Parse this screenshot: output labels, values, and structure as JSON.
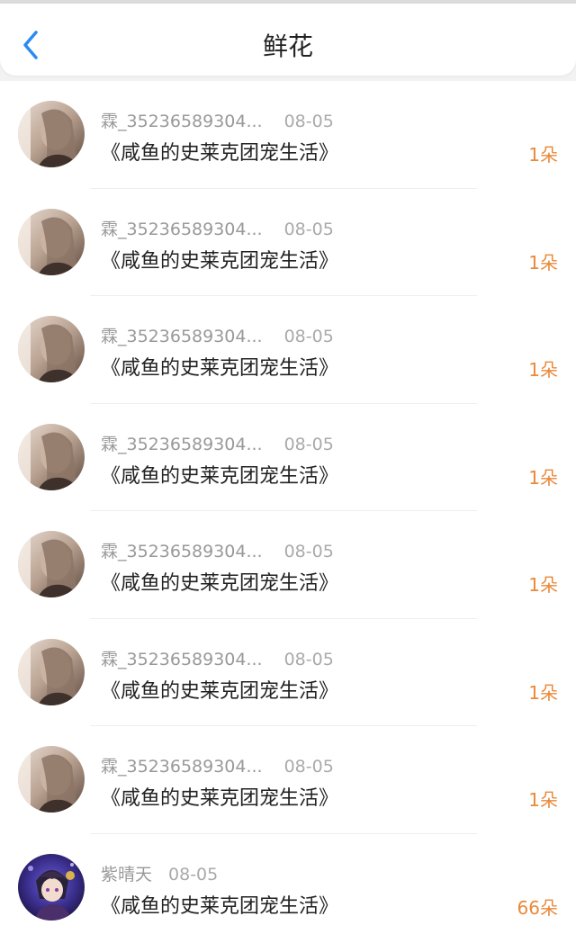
{
  "header": {
    "title": "鲜花",
    "back_icon": "chevron-left-icon",
    "accent": "#2a8cf0"
  },
  "count_color": "#e9893a",
  "records": [
    {
      "user": "霖_35236589304...",
      "date": "08-05",
      "book": "《咸鱼的史莱克团宠生活》",
      "count": "1朵",
      "avatar": "portrait-light"
    },
    {
      "user": "霖_35236589304...",
      "date": "08-05",
      "book": "《咸鱼的史莱克团宠生活》",
      "count": "1朵",
      "avatar": "portrait-light"
    },
    {
      "user": "霖_35236589304...",
      "date": "08-05",
      "book": "《咸鱼的史莱克团宠生活》",
      "count": "1朵",
      "avatar": "portrait-light"
    },
    {
      "user": "霖_35236589304...",
      "date": "08-05",
      "book": "《咸鱼的史莱克团宠生活》",
      "count": "1朵",
      "avatar": "portrait-light"
    },
    {
      "user": "霖_35236589304...",
      "date": "08-05",
      "book": "《咸鱼的史莱克团宠生活》",
      "count": "1朵",
      "avatar": "portrait-light"
    },
    {
      "user": "霖_35236589304...",
      "date": "08-05",
      "book": "《咸鱼的史莱克团宠生活》",
      "count": "1朵",
      "avatar": "portrait-light"
    },
    {
      "user": "霖_35236589304...",
      "date": "08-05",
      "book": "《咸鱼的史莱克团宠生活》",
      "count": "1朵",
      "avatar": "portrait-light"
    },
    {
      "user": "紫晴天",
      "date": "08-05",
      "book": "《咸鱼的史莱克团宠生活》",
      "count": "66朵",
      "avatar": "anime-character"
    }
  ]
}
